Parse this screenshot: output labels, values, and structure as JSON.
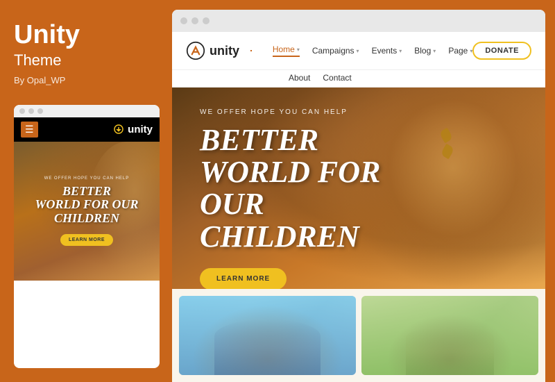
{
  "sidebar": {
    "title": "Unity",
    "subtitle": "Theme",
    "by": "By Opal_WP"
  },
  "mobile_preview": {
    "dots": [
      "dot1",
      "dot2",
      "dot3"
    ],
    "nav": {
      "logo": "unity",
      "hamburger": "☰"
    },
    "hero": {
      "small_label": "WE OFFER HOPE YOU CAN HELP",
      "title_line1": "BETTER",
      "title_line2": "WORLD FOR OUR",
      "title_line3": "CHILDREN",
      "cta": "LEARN MORE"
    }
  },
  "browser": {
    "dots": [
      "dot1",
      "dot2",
      "dot3"
    ]
  },
  "website": {
    "nav": {
      "logo": "unity",
      "links": [
        {
          "label": "Home",
          "has_dropdown": true,
          "active": true
        },
        {
          "label": "Campaigns",
          "has_dropdown": true,
          "active": false
        },
        {
          "label": "Events",
          "has_dropdown": true,
          "active": false
        },
        {
          "label": "Blog",
          "has_dropdown": true,
          "active": false
        },
        {
          "label": "Page",
          "has_dropdown": true,
          "active": false
        }
      ],
      "secondary_links": [
        {
          "label": "About",
          "active": false
        },
        {
          "label": "Contact",
          "active": false
        }
      ],
      "donate_button": "DONATE"
    },
    "hero": {
      "small_label": "WE OFFER HOPE YOU CAN HELP",
      "title_line1": "BETTER",
      "title_line2": "WORLD FOR OUR",
      "title_line3": "CHILDREN",
      "cta": "LEARN MORE"
    }
  },
  "colors": {
    "brand_orange": "#c8651a",
    "brand_yellow": "#f0c020",
    "nav_active": "#c8651a"
  }
}
